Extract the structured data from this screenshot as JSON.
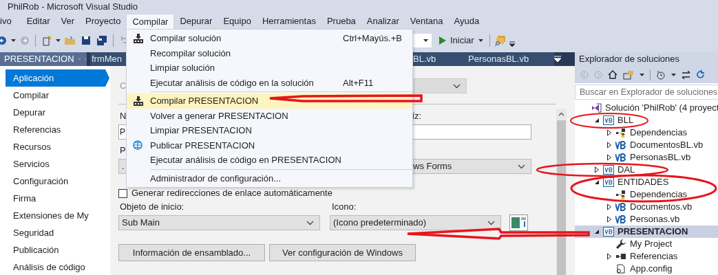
{
  "window": {
    "title": "PhilRob - Microsoft Visual Studio"
  },
  "menu_bar": [
    {
      "label": "ivo",
      "selected": false
    },
    {
      "label": "Editar",
      "selected": false
    },
    {
      "label": "Ver",
      "selected": false
    },
    {
      "label": "Proyecto",
      "selected": false
    },
    {
      "label": "Compilar",
      "selected": true
    },
    {
      "label": "Depurar",
      "selected": false
    },
    {
      "label": "Equipo",
      "selected": false
    },
    {
      "label": "Herramientas",
      "selected": false
    },
    {
      "label": "Prueba",
      "selected": false
    },
    {
      "label": "Analizar",
      "selected": false
    },
    {
      "label": "Ventana",
      "selected": false
    },
    {
      "label": "Ayuda",
      "selected": false
    }
  ],
  "toolbar": {
    "start_button": "Iniciar"
  },
  "tabs": [
    {
      "label": "PRESENTACION",
      "selected": true
    },
    {
      "label": "frmMen",
      "selected": false
    },
    {
      "label": "BL.vb",
      "selected": false
    },
    {
      "label": "PersonasBL.vb",
      "selected": false
    }
  ],
  "dropdown_menu": {
    "groups": [
      [
        {
          "label": "Compilar solución",
          "shortcut": "Ctrl+Mayús.+B",
          "kind": "build",
          "selected": false
        },
        {
          "label": "Recompilar solución",
          "kind": "plain",
          "selected": false
        },
        {
          "label": "Limpiar solución",
          "kind": "plain",
          "selected": false
        },
        {
          "label": "Ejecutar análisis de código en la solución",
          "shortcut": "Alt+F11",
          "kind": "plain",
          "selected": false
        }
      ],
      [
        {
          "label": "Compilar PRESENTACION",
          "kind": "build",
          "selected": true
        },
        {
          "label": "Volver a generar PRESENTACION",
          "kind": "plain",
          "selected": false
        },
        {
          "label": "Limpiar PRESENTACION",
          "kind": "plain",
          "selected": false
        },
        {
          "label": "Publicar PRESENTACION",
          "kind": "globe",
          "selected": false
        },
        {
          "label": "Ejecutar análisis de código en PRESENTACION",
          "kind": "plain",
          "selected": false
        }
      ],
      [
        {
          "label": "Administrador de configuración...",
          "kind": "plain",
          "selected": false
        }
      ]
    ]
  },
  "sidebar": {
    "items": [
      {
        "label": "Aplicación",
        "selected": true
      },
      {
        "label": "Compilar",
        "selected": false
      },
      {
        "label": "Depurar",
        "selected": false
      },
      {
        "label": "Referencias",
        "selected": false
      },
      {
        "label": "Recursos",
        "selected": false
      },
      {
        "label": "Servicios",
        "selected": false
      },
      {
        "label": "Configuración",
        "selected": false
      },
      {
        "label": "Firma",
        "selected": false
      },
      {
        "label": "Extensiones de My",
        "selected": false
      },
      {
        "label": "Seguridad",
        "selected": false
      },
      {
        "label": "Publicación",
        "selected": false
      },
      {
        "label": "Análisis de código",
        "selected": false
      }
    ]
  },
  "form": {
    "top_label": "C",
    "label_1": "N",
    "label_2": "íz:",
    "field_1_value": "P",
    "label_3": "P",
    "select_1_value": ".",
    "select_2_value": "ws Forms",
    "checkbox": {
      "label": "Generar redirecciones de enlace automáticamente",
      "checked": false
    },
    "startup_label": "Objeto de inicio:",
    "startup_value": "Sub Main",
    "icon_label": "Icono:",
    "icon_value": "(Icono predeterminado)",
    "buttons": [
      "Información de ensamblado...",
      "Ver configuración de Windows"
    ]
  },
  "solution_explorer": {
    "title": "Explorador de soluciones",
    "search": {
      "placeholder": "Buscar en Explorador de soluciones"
    },
    "tree": [
      {
        "label": "Solución 'PhilRob' (4 proyect",
        "kind": "solution",
        "selected": false,
        "children": [
          {
            "label": "BLL",
            "kind": "project",
            "expanded": true,
            "selected": false,
            "children": [
              {
                "label": "Dependencias",
                "kind": "deps",
                "expanded": false,
                "selected": false
              },
              {
                "label": "DocumentosBL.vb",
                "kind": "vb",
                "expanded": false,
                "selected": false
              },
              {
                "label": "PersonasBL.vb",
                "kind": "vb",
                "expanded": false,
                "selected": false
              }
            ]
          },
          {
            "label": "DAL",
            "kind": "project",
            "expanded": false,
            "selected": false
          },
          {
            "label": "ENTIDADES",
            "kind": "project",
            "expanded": true,
            "selected": false,
            "children": [
              {
                "label": "Dependencias",
                "kind": "deps",
                "selected": false
              },
              {
                "label": "Documentos.vb",
                "kind": "vb",
                "expanded": false,
                "selected": false
              },
              {
                "label": "Personas.vb",
                "kind": "vb",
                "expanded": false,
                "selected": false
              }
            ]
          },
          {
            "label": "PRESENTACION",
            "kind": "project",
            "expanded": true,
            "selected": true,
            "children": [
              {
                "label": "My Project",
                "kind": "wrench",
                "selected": false
              },
              {
                "label": "Referencias",
                "kind": "refs",
                "expanded": false,
                "selected": false
              },
              {
                "label": "App.config",
                "kind": "config",
                "selected": false
              }
            ]
          }
        ]
      }
    ]
  }
}
